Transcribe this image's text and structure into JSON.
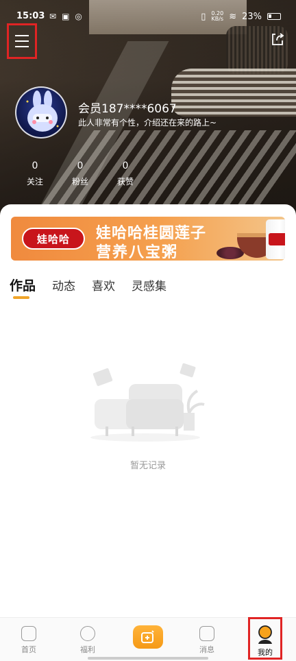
{
  "statusbar": {
    "time": "15:03",
    "net_speed_value": "0.20",
    "net_speed_unit": "KB/s",
    "battery": "23%"
  },
  "profile": {
    "username": "会员187****6067",
    "bio": "此人非常有个性，介绍还在来的路上~"
  },
  "stats": [
    {
      "value": "0",
      "label": "关注"
    },
    {
      "value": "0",
      "label": "粉丝"
    },
    {
      "value": "0",
      "label": "获赞"
    }
  ],
  "banner": {
    "brand": "娃哈哈",
    "line1": "娃哈哈桂圆莲子",
    "line2": "营养八宝粥"
  },
  "tabs": [
    {
      "label": "作品",
      "active": true
    },
    {
      "label": "动态",
      "active": false
    },
    {
      "label": "喜欢",
      "active": false
    },
    {
      "label": "灵感集",
      "active": false
    }
  ],
  "empty_state": {
    "text": "暂无记录"
  },
  "bottom_nav": [
    {
      "label": "首页",
      "icon": "home-icon"
    },
    {
      "label": "福利",
      "icon": "gift-icon"
    },
    {
      "label": "",
      "icon": "add-post-icon"
    },
    {
      "label": "消息",
      "icon": "message-icon"
    },
    {
      "label": "我的",
      "icon": "profile-icon"
    }
  ],
  "colors": {
    "accent": "#f59a16",
    "highlight_box": "#e02424"
  }
}
